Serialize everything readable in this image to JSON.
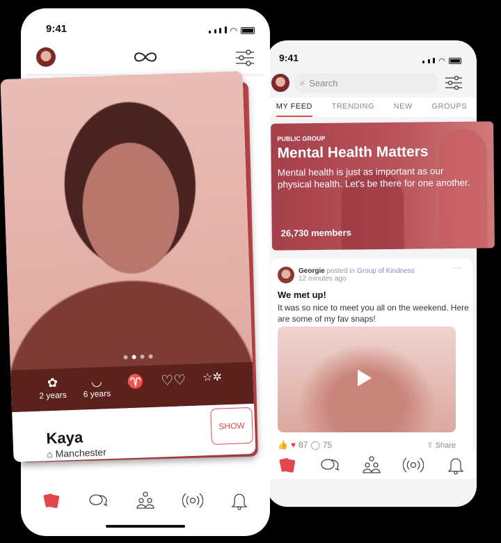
{
  "left_phone": {
    "time": "9:41",
    "profile": {
      "name": "Kaya",
      "location": "Manchester",
      "show_label": "SHOW",
      "photo_dots": 4,
      "active_dot": 2,
      "badges": [
        {
          "icon": "bow-diaper-icon",
          "label": "2 years"
        },
        {
          "icon": "diaper-icon",
          "label": "6 years"
        },
        {
          "icon": "aries-icon",
          "label": ""
        },
        {
          "icon": "hearts-icon",
          "label": ""
        },
        {
          "icon": "stars-icon",
          "label": ""
        }
      ]
    }
  },
  "right_phone": {
    "time": "9:41",
    "search_placeholder": "Search",
    "tabs": [
      "MY FEED",
      "TRENDING",
      "NEW",
      "GROUPS"
    ],
    "group": {
      "tag": "PUBLIC GROUP",
      "title": "Mental Health Matters",
      "description": "Mental health is just as important as our physical health. Let's be there for one another.",
      "members": "26,730 members"
    },
    "post": {
      "author": "Georgie",
      "posted_in": "posted in",
      "group": "Group of Kindness",
      "time": "12 minutes ago",
      "title": "We met up!",
      "body": "It was so nice to meet you all on the weekend. Here are some of my fav snaps!",
      "reactions": "87",
      "comments": "75",
      "share": "Share"
    }
  },
  "colors": {
    "accent": "#e2474b",
    "group_card": "#a8404a",
    "photo_tint": "#d8a9a4",
    "link": "#9b7fc9"
  }
}
